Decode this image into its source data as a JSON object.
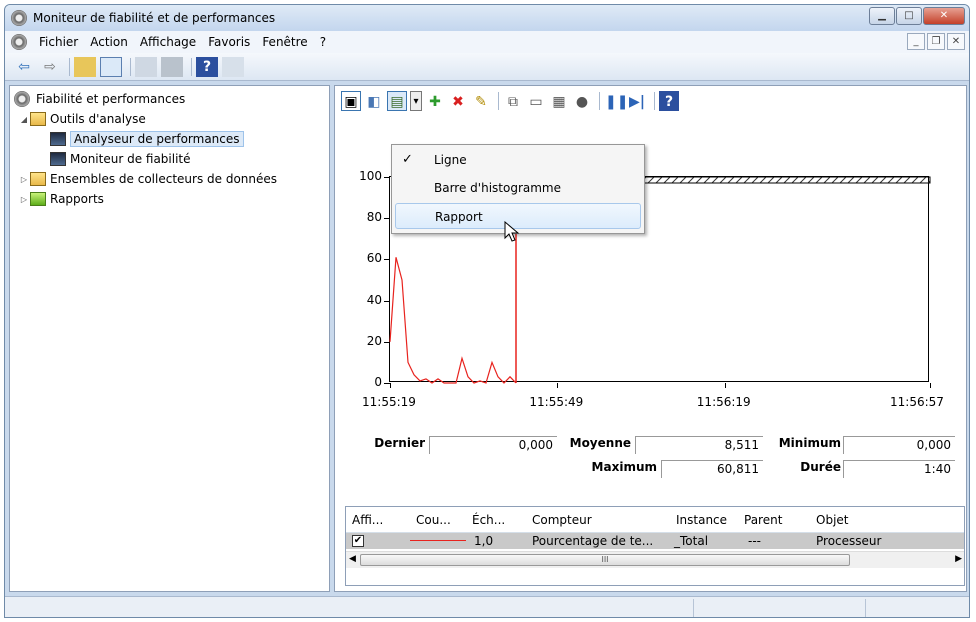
{
  "window": {
    "title": "Moniteur de fiabilité et de performances",
    "buttons": {
      "minimize": "▁",
      "maximize": "□",
      "close": "✕"
    }
  },
  "menubar": {
    "items": [
      "Fichier",
      "Action",
      "Affichage",
      "Favoris",
      "Fenêtre",
      "?"
    ],
    "mdi": {
      "minimize": "_",
      "restore": "❐",
      "close": "✕"
    }
  },
  "tree": {
    "root": "Fiabilité et performances",
    "tools": "Outils d'analyse",
    "perf": "Analyseur de performances",
    "reliab": "Moniteur de fiabilité",
    "sets": "Ensembles de collecteurs de données",
    "reports": "Rapports"
  },
  "dropdown": {
    "items": [
      "Ligne",
      "Barre d'histogramme",
      "Rapport"
    ],
    "checked": "✓",
    "checked_index": 0,
    "hover_index": 2
  },
  "chart_data": {
    "type": "line",
    "ylim": [
      0,
      100
    ],
    "yticks": [
      "0",
      "20",
      "40",
      "60",
      "80",
      "100"
    ],
    "xticks": [
      "11:55:19",
      "11:55:49",
      "11:56:19",
      "11:56:57"
    ],
    "series": [
      {
        "color": "#e8231e",
        "values": [
          20,
          61,
          50,
          10,
          4,
          1,
          2,
          0,
          2,
          0,
          0,
          0,
          12,
          3,
          0,
          1,
          0,
          10,
          3,
          0,
          3,
          0
        ]
      }
    ],
    "cursor_color": "#e8231e"
  },
  "stats": {
    "last_label": "Dernier",
    "last": "0,000",
    "avg_label": "Moyenne",
    "avg": "8,511",
    "min_label": "Minimum",
    "min": "0,000",
    "max_label": "Maximum",
    "max": "60,811",
    "dur_label": "Durée",
    "dur": "1:40"
  },
  "list": {
    "headers": [
      "Affi...",
      "Cou...",
      "Éch...",
      "Compteur",
      "Instance",
      "Parent",
      "Objet"
    ],
    "row": {
      "show": "✔",
      "scale": "1,0",
      "counter": "Pourcentage de te...",
      "instance": "_Total",
      "parent": "---",
      "object": "Processeur"
    },
    "scroll_grip": "III"
  },
  "icons": {
    "back": "⇦",
    "forward": "⇨",
    "add": "✚",
    "delete": "✖",
    "highlight": "✎",
    "pause": "❚❚",
    "next": "▶|",
    "help": "?",
    "dropdown": "▾"
  }
}
